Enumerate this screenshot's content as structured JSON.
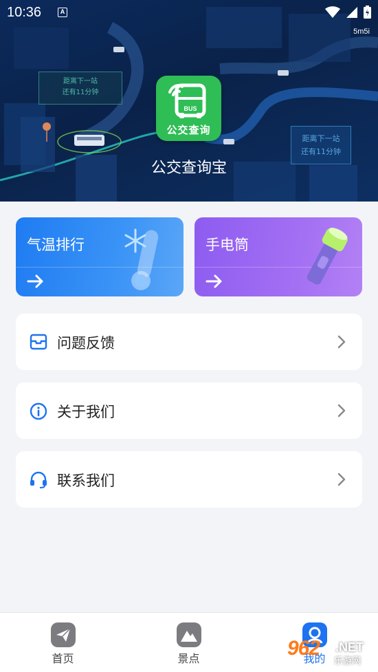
{
  "status_bar": {
    "time": "10:36",
    "notification_badge": "A"
  },
  "hero": {
    "watermark": "5m5i",
    "info_box_left": {
      "line1": "距离下一站",
      "line2": "还有11分钟"
    },
    "info_box_right": {
      "line1": "距离下一站",
      "line2": "还有11分钟"
    },
    "app_icon": {
      "badge_text": "BUS",
      "label": "公交查询",
      "color": "#2fbd56"
    },
    "app_name": "公交查询宝"
  },
  "features": [
    {
      "title": "气温排行",
      "icon": "thermometer-snowflake-icon",
      "color": "#1f7cf2"
    },
    {
      "title": "手电筒",
      "icon": "flashlight-icon",
      "color": "#8d5cf0"
    }
  ],
  "menu": {
    "feedback": {
      "label": "问题反馈",
      "icon": "mail-icon"
    },
    "about": {
      "label": "关于我们",
      "icon": "info-icon"
    },
    "contact": {
      "label": "联系我们",
      "icon": "headset-icon"
    }
  },
  "bottom_nav": {
    "home": {
      "label": "首页",
      "icon": "paper-plane-icon"
    },
    "scenic": {
      "label": "景点",
      "icon": "mountain-icon"
    },
    "mine": {
      "label": "我的",
      "icon": "user-icon",
      "active": true
    }
  },
  "watermark_bottom": {
    "number": "962",
    "suffix": ".NET",
    "text": "乐游网"
  },
  "colors": {
    "accent": "#1d73f0",
    "hero_bg": "#0b2a5c",
    "page_bg": "#f3f4f8"
  }
}
